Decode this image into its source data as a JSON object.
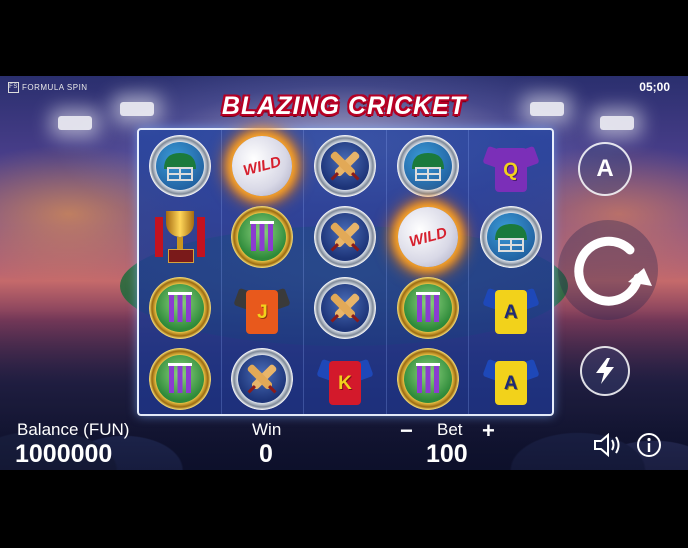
{
  "brand": {
    "logo_text": "FORMULA SPIN"
  },
  "clock": "05;00",
  "game": {
    "title": "BLAZING CRICKET"
  },
  "reels": [
    [
      "helmet",
      "wild",
      "bats",
      "helmet",
      "shirt-purple-q"
    ],
    [
      "trophy",
      "stumps",
      "bats",
      "wild",
      "helmet"
    ],
    [
      "stumps",
      "shirt-orange-j",
      "bats",
      "stumps",
      "shirt-yellow-a"
    ],
    [
      "stumps",
      "bats",
      "shirt-red-k",
      "stumps",
      "shirt-yellow-a"
    ]
  ],
  "symbols": {
    "wild_label": "WILD",
    "shirt_letters": {
      "q": "Q",
      "j": "J",
      "k": "K",
      "a": "A"
    }
  },
  "controls": {
    "autoplay_label": "A",
    "balance_label": "Balance (FUN)",
    "balance_value": "1000000",
    "win_label": "Win",
    "win_value": "0",
    "bet_label": "Bet",
    "bet_value": "100",
    "minus": "−",
    "plus": "+"
  },
  "colors": {
    "title_outline": "#b30024",
    "reel_frame": "#e7eefc",
    "shirt_purple": "#7b2fb8",
    "shirt_orange": "#e8591c",
    "shirt_red": "#d3192b",
    "shirt_yellow": "#f2d21b",
    "shirt_blue": "#1e48b8"
  }
}
